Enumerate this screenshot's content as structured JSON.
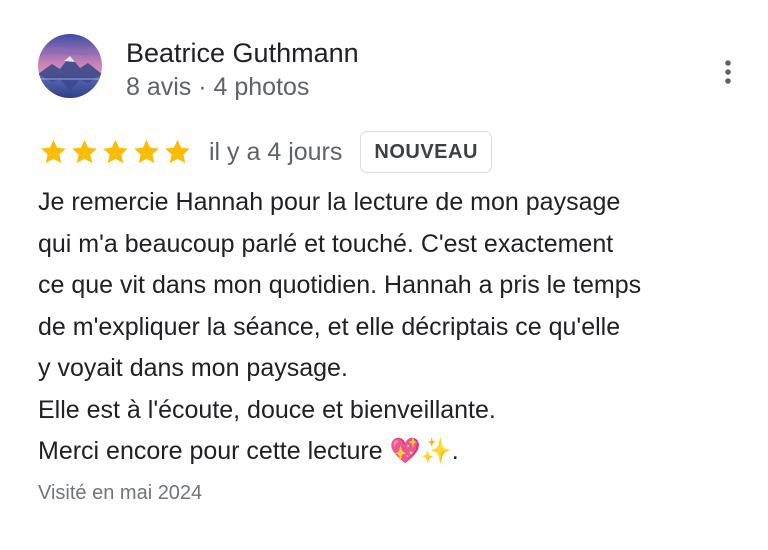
{
  "author": {
    "name": "Beatrice Guthmann",
    "meta": "8 avis · 4 photos",
    "avatar_icon": "landscape-avatar"
  },
  "review": {
    "rating": 5,
    "rating_max": 5,
    "star_color": "#fbbc04",
    "date": "il y a 4 jours",
    "badge": "NOUVEAU",
    "lines": [
      "Je remercie Hannah pour la lecture de mon paysage",
      "qui m'a beaucoup parlé et touché. C'est exactement",
      "ce que vit dans mon quotidien. Hannah a pris le temps",
      "de m'expliquer la séance, et elle décriptais  ce qu'elle",
      "y voyait dans mon paysage.",
      "Elle est à l'écoute, douce et bienveillante.",
      "Merci encore pour cette lecture 💖✨."
    ],
    "visit": "Visité en mai 2024"
  },
  "menu": {
    "icon": "more-vert-icon"
  }
}
